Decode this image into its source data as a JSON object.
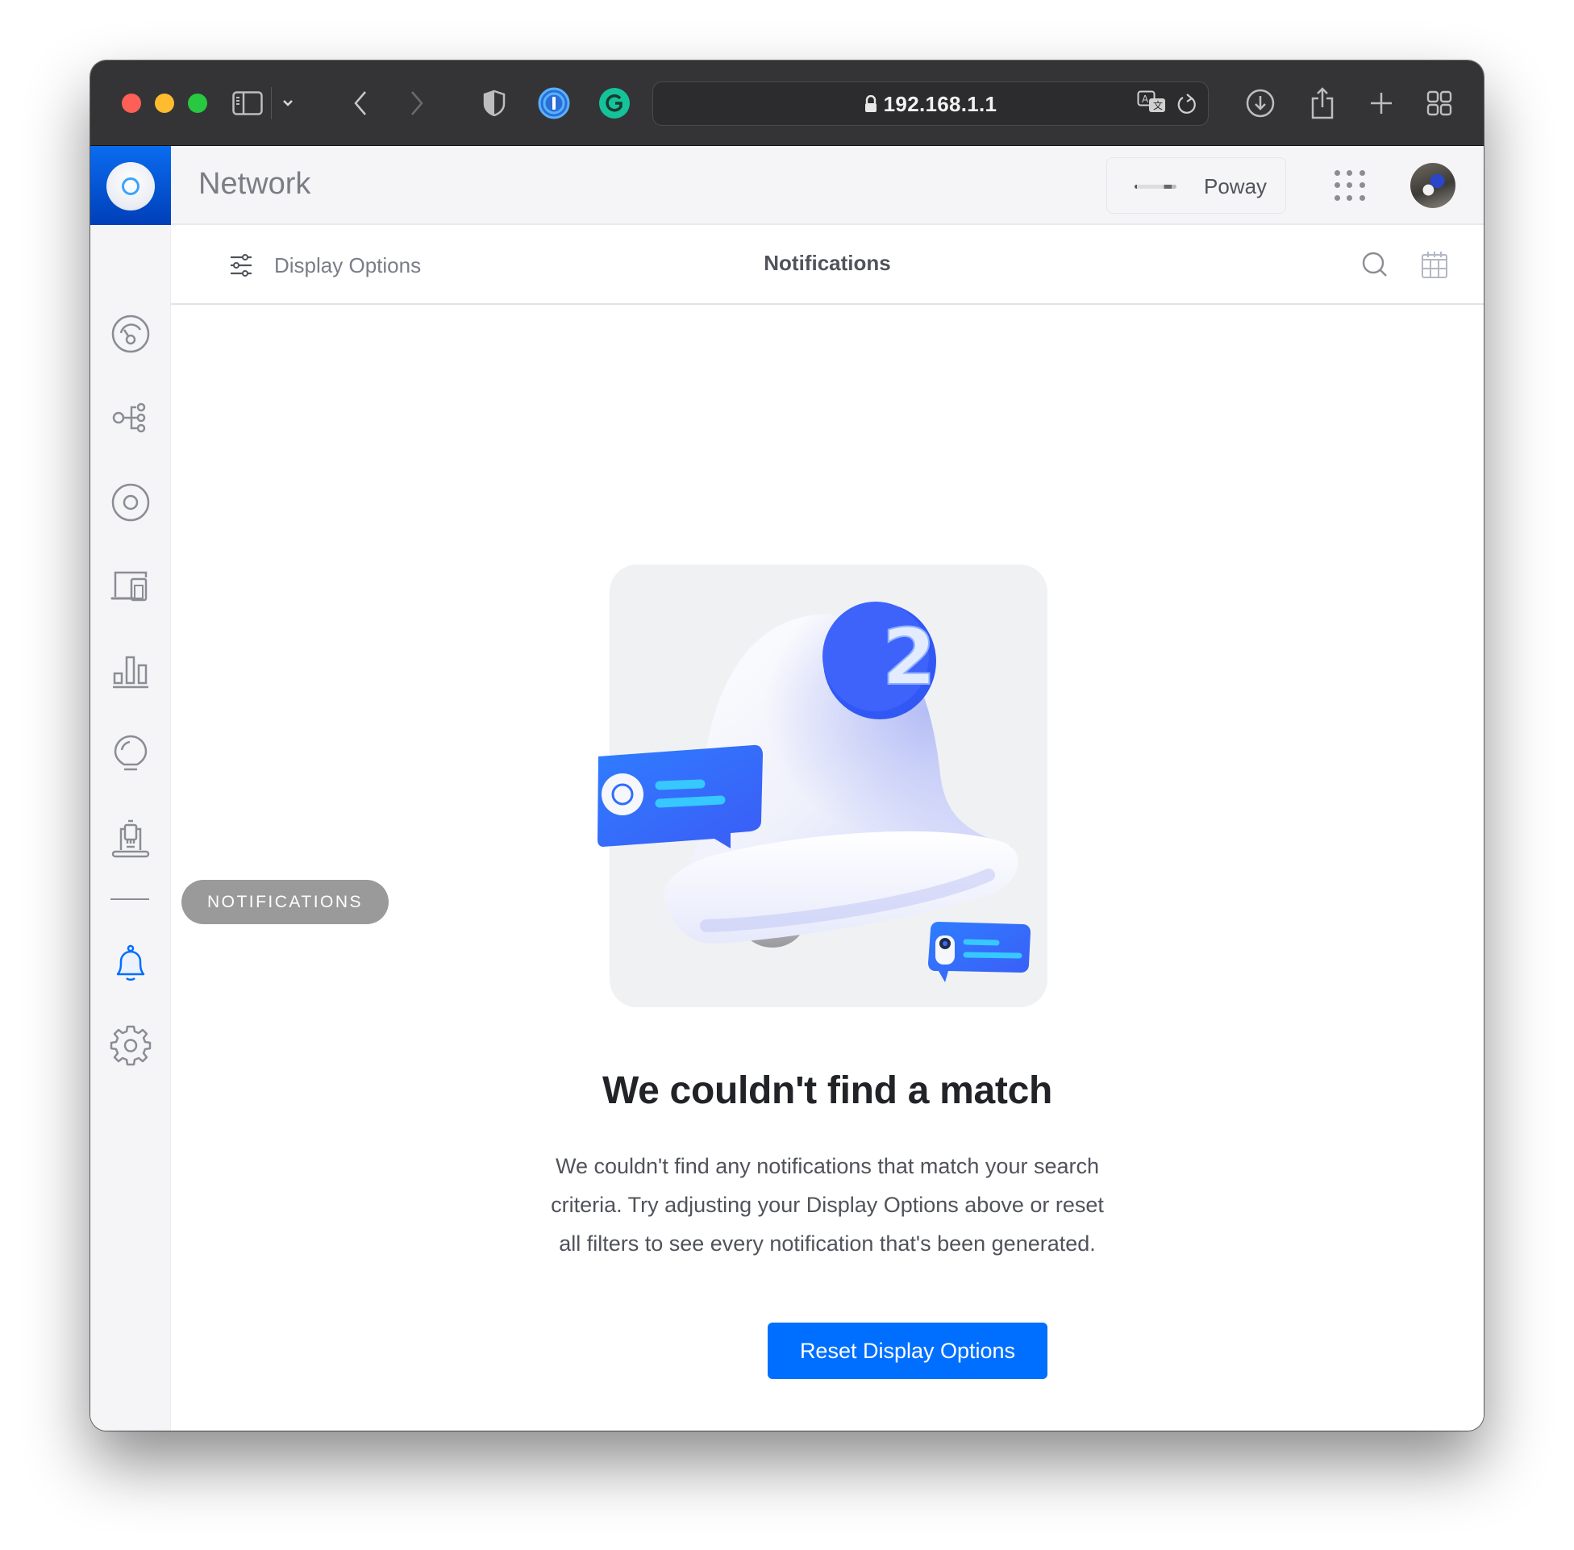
{
  "browser": {
    "url": "192.168.1.1",
    "toolbar_icons": [
      "sidebar-toggle-icon",
      "chevron-down-icon",
      "back-icon",
      "forward-icon",
      "privacy-shield-icon",
      "1password-icon",
      "grammarly-icon",
      "translate-icon",
      "reload-icon",
      "download-icon",
      "share-icon",
      "new-tab-icon",
      "tab-overview-icon"
    ]
  },
  "app": {
    "title": "Network",
    "site_name": "Poway"
  },
  "sidebar": {
    "items": [
      {
        "name": "dashboard",
        "icon": "dashboard-gauge-icon"
      },
      {
        "name": "topology",
        "icon": "topology-icon"
      },
      {
        "name": "devices",
        "icon": "unifi-device-icon"
      },
      {
        "name": "client-devices",
        "icon": "clients-icon"
      },
      {
        "name": "statistics",
        "icon": "bar-chart-icon"
      },
      {
        "name": "insights",
        "icon": "lightbulb-icon"
      },
      {
        "name": "system-log",
        "icon": "system-log-icon"
      },
      {
        "name": "notifications",
        "icon": "bell-icon",
        "active": true
      },
      {
        "name": "settings",
        "icon": "gear-icon"
      }
    ],
    "tooltip": "NOTIFICATIONS"
  },
  "toolbar": {
    "display_options_label": "Display Options",
    "page_title": "Notifications"
  },
  "empty_state": {
    "badge_count": "2",
    "heading": "We couldn't find a match",
    "body": "We couldn't find any notifications that match your search criteria. Try adjusting your Display Options above or reset all filters to see every notification that's been generated.",
    "button_label": "Reset Display Options"
  },
  "colors": {
    "accent": "#006fff",
    "active_icon": "#006fff",
    "icon_gray": "#8a8d94",
    "titlebar": "#343436"
  }
}
